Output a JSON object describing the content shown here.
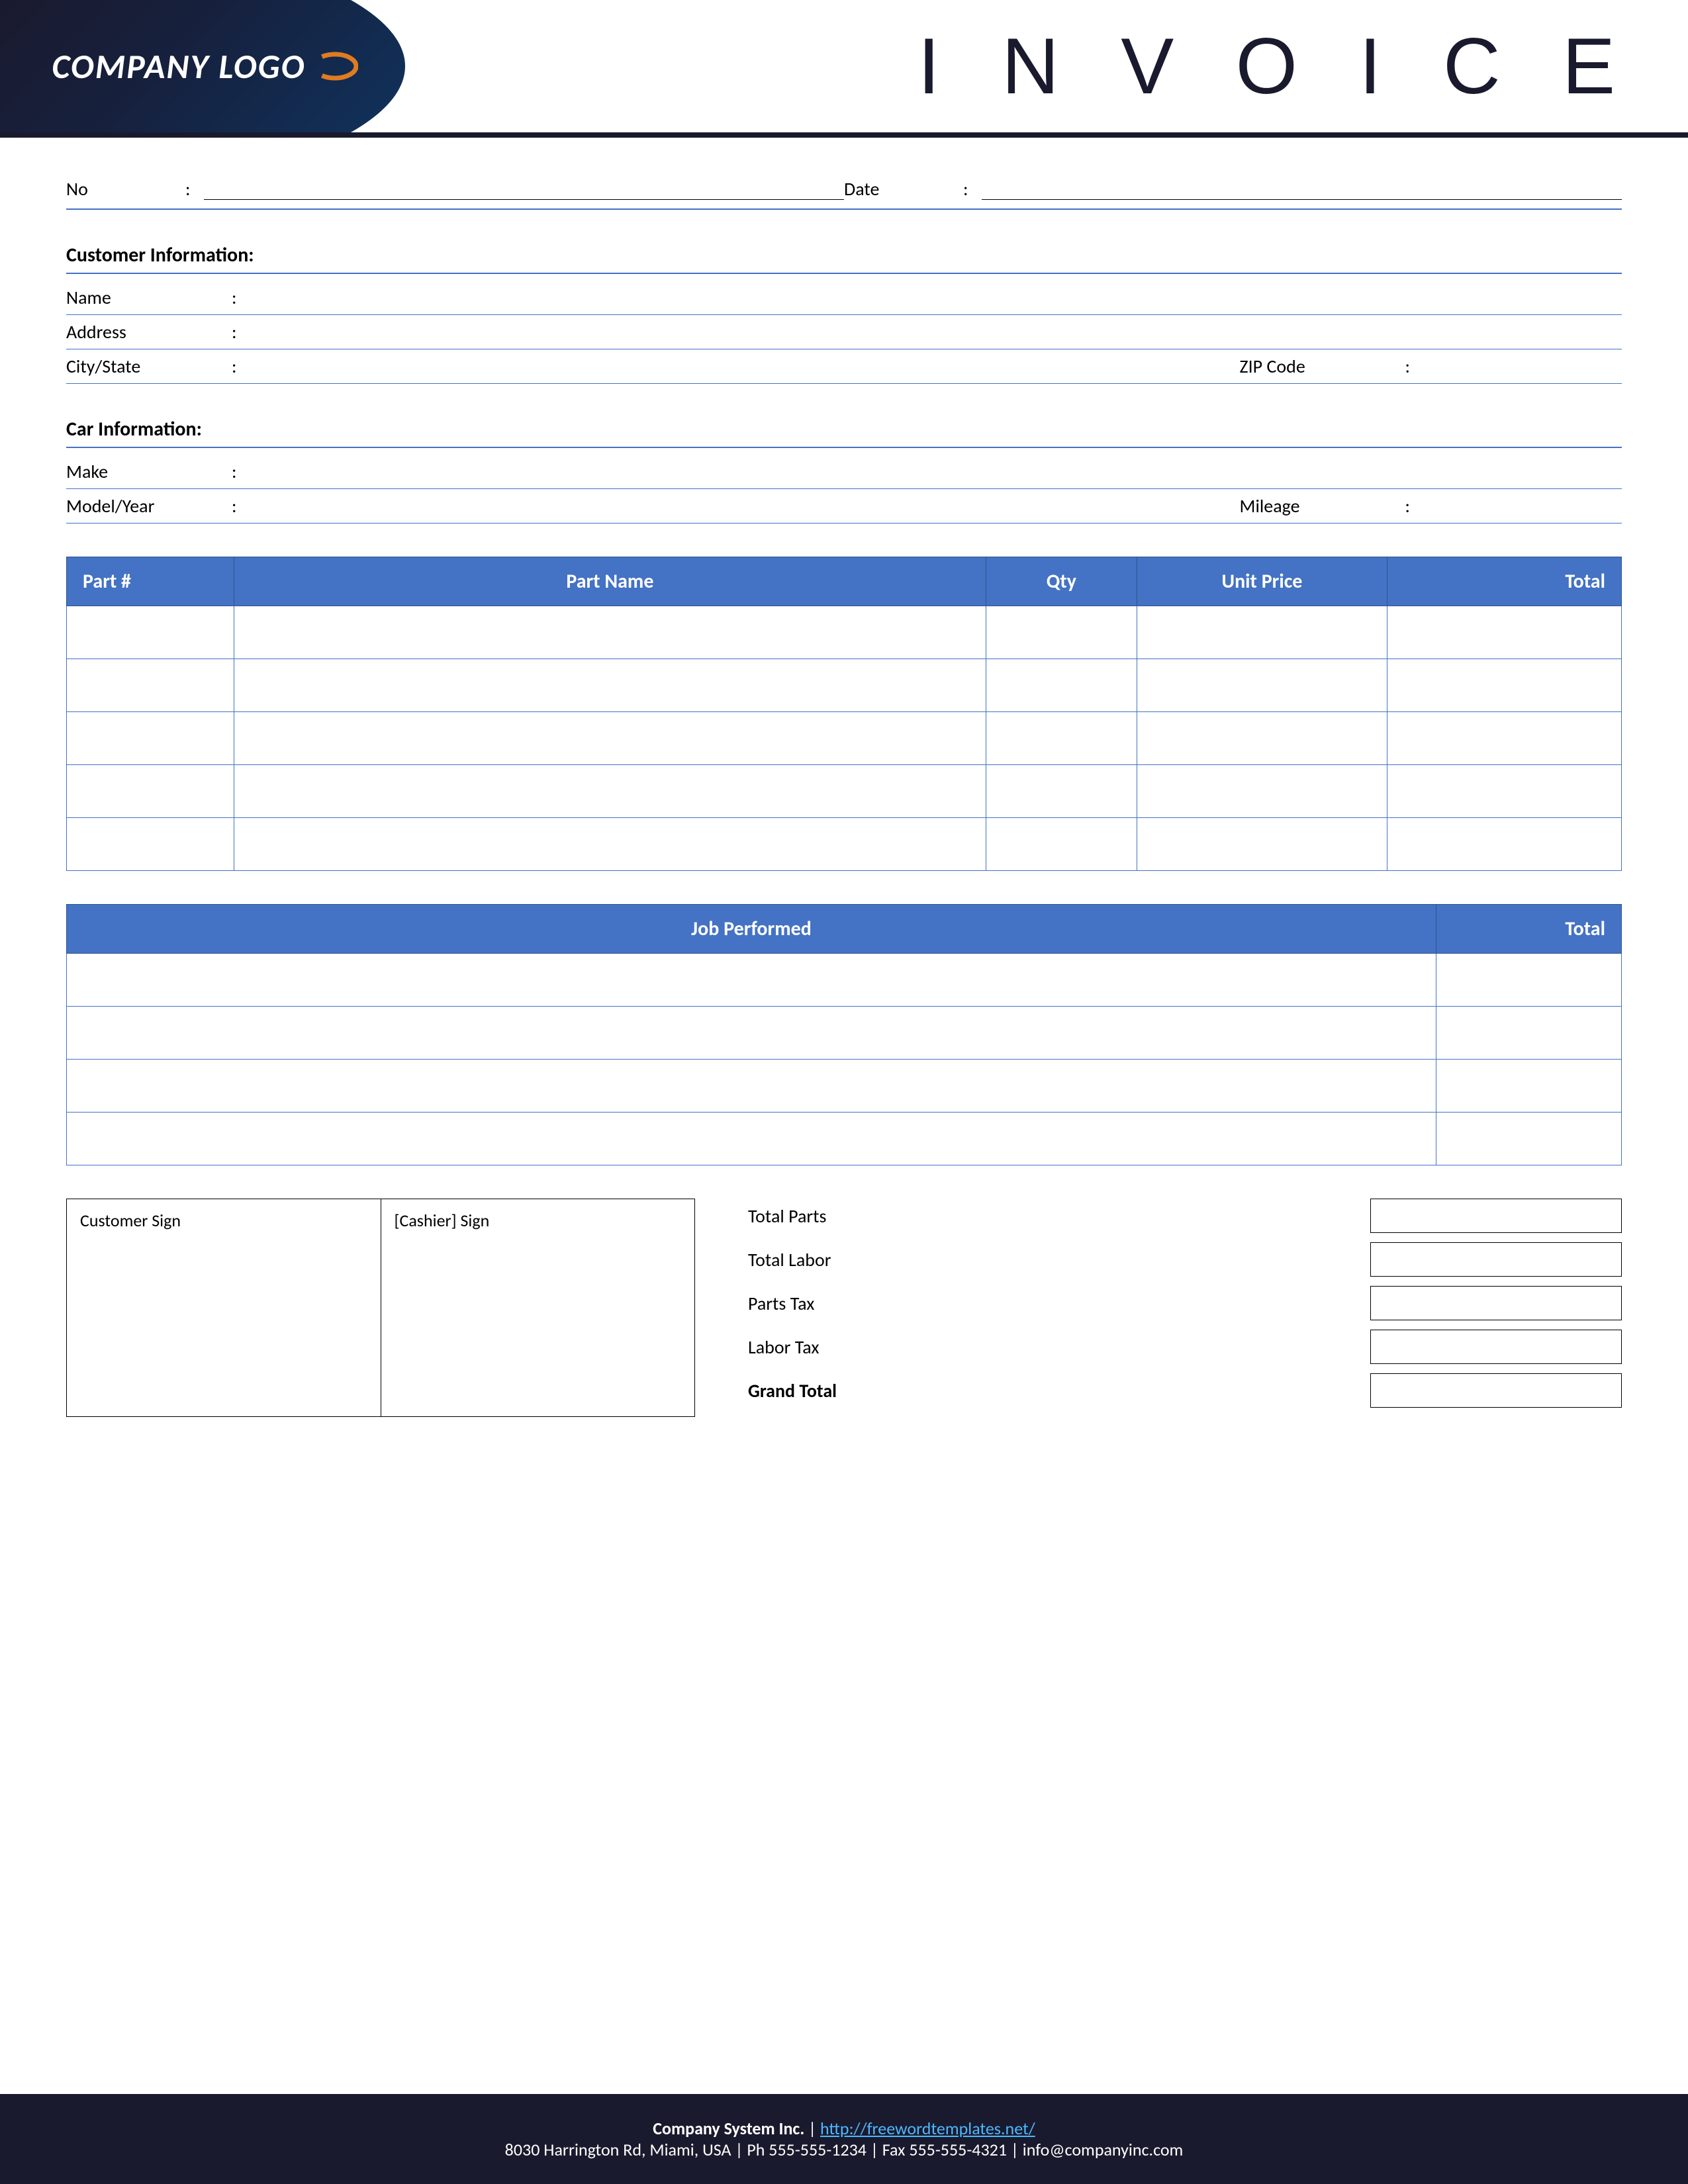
{
  "header": {
    "logo_text": "COMPANY LOGO",
    "invoice_title": "I N V O I C E"
  },
  "form": {
    "no_label": "No",
    "no_colon": ":",
    "date_label": "Date",
    "date_colon": ":"
  },
  "customer_info": {
    "section_title": "Customer Information:",
    "name_label": "Name",
    "name_colon": ":",
    "address_label": "Address",
    "address_colon": ":",
    "city_state_label": "City/State",
    "city_state_colon": ":",
    "zip_label": "ZIP Code",
    "zip_colon": ":"
  },
  "car_info": {
    "section_title": "Car Information:",
    "make_label": "Make",
    "make_colon": ":",
    "model_year_label": "Model/Year",
    "model_year_colon": ":",
    "mileage_label": "Mileage",
    "mileage_colon": ":"
  },
  "parts_table": {
    "col_part_num": "Part #",
    "col_part_name": "Part Name",
    "col_qty": "Qty",
    "col_unit_price": "Unit Price",
    "col_total": "Total",
    "rows": [
      {
        "part_num": "",
        "part_name": "",
        "qty": "",
        "unit_price": "",
        "total": ""
      },
      {
        "part_num": "",
        "part_name": "",
        "qty": "",
        "unit_price": "",
        "total": ""
      },
      {
        "part_num": "",
        "part_name": "",
        "qty": "",
        "unit_price": "",
        "total": ""
      },
      {
        "part_num": "",
        "part_name": "",
        "qty": "",
        "unit_price": "",
        "total": ""
      },
      {
        "part_num": "",
        "part_name": "",
        "qty": "",
        "unit_price": "",
        "total": ""
      }
    ]
  },
  "job_table": {
    "col_job": "Job Performed",
    "col_total": "Total",
    "rows": [
      {
        "job": "",
        "total": ""
      },
      {
        "job": "",
        "total": ""
      },
      {
        "job": "",
        "total": ""
      },
      {
        "job": "",
        "total": ""
      }
    ]
  },
  "signatures": {
    "customer_sign": "Customer Sign",
    "cashier_sign": "[Cashier] Sign"
  },
  "totals": {
    "total_parts_label": "Total Parts",
    "total_labor_label": "Total Labor",
    "parts_tax_label": "Parts Tax",
    "labor_tax_label": "Labor Tax",
    "grand_total_label": "Grand Total"
  },
  "footer": {
    "company_name": "Company System Inc.",
    "separator": "|",
    "website": "http://freewordtemplates.net/",
    "address_line": "8030 Harrington Rd, Miami, USA | Ph 555-555-1234 | Fax 555-555-4321 | info@companyinc.com"
  },
  "colors": {
    "header_bg": "#1a1a2e",
    "accent_blue": "#4472c4",
    "footer_bg": "#1a1a2e"
  }
}
